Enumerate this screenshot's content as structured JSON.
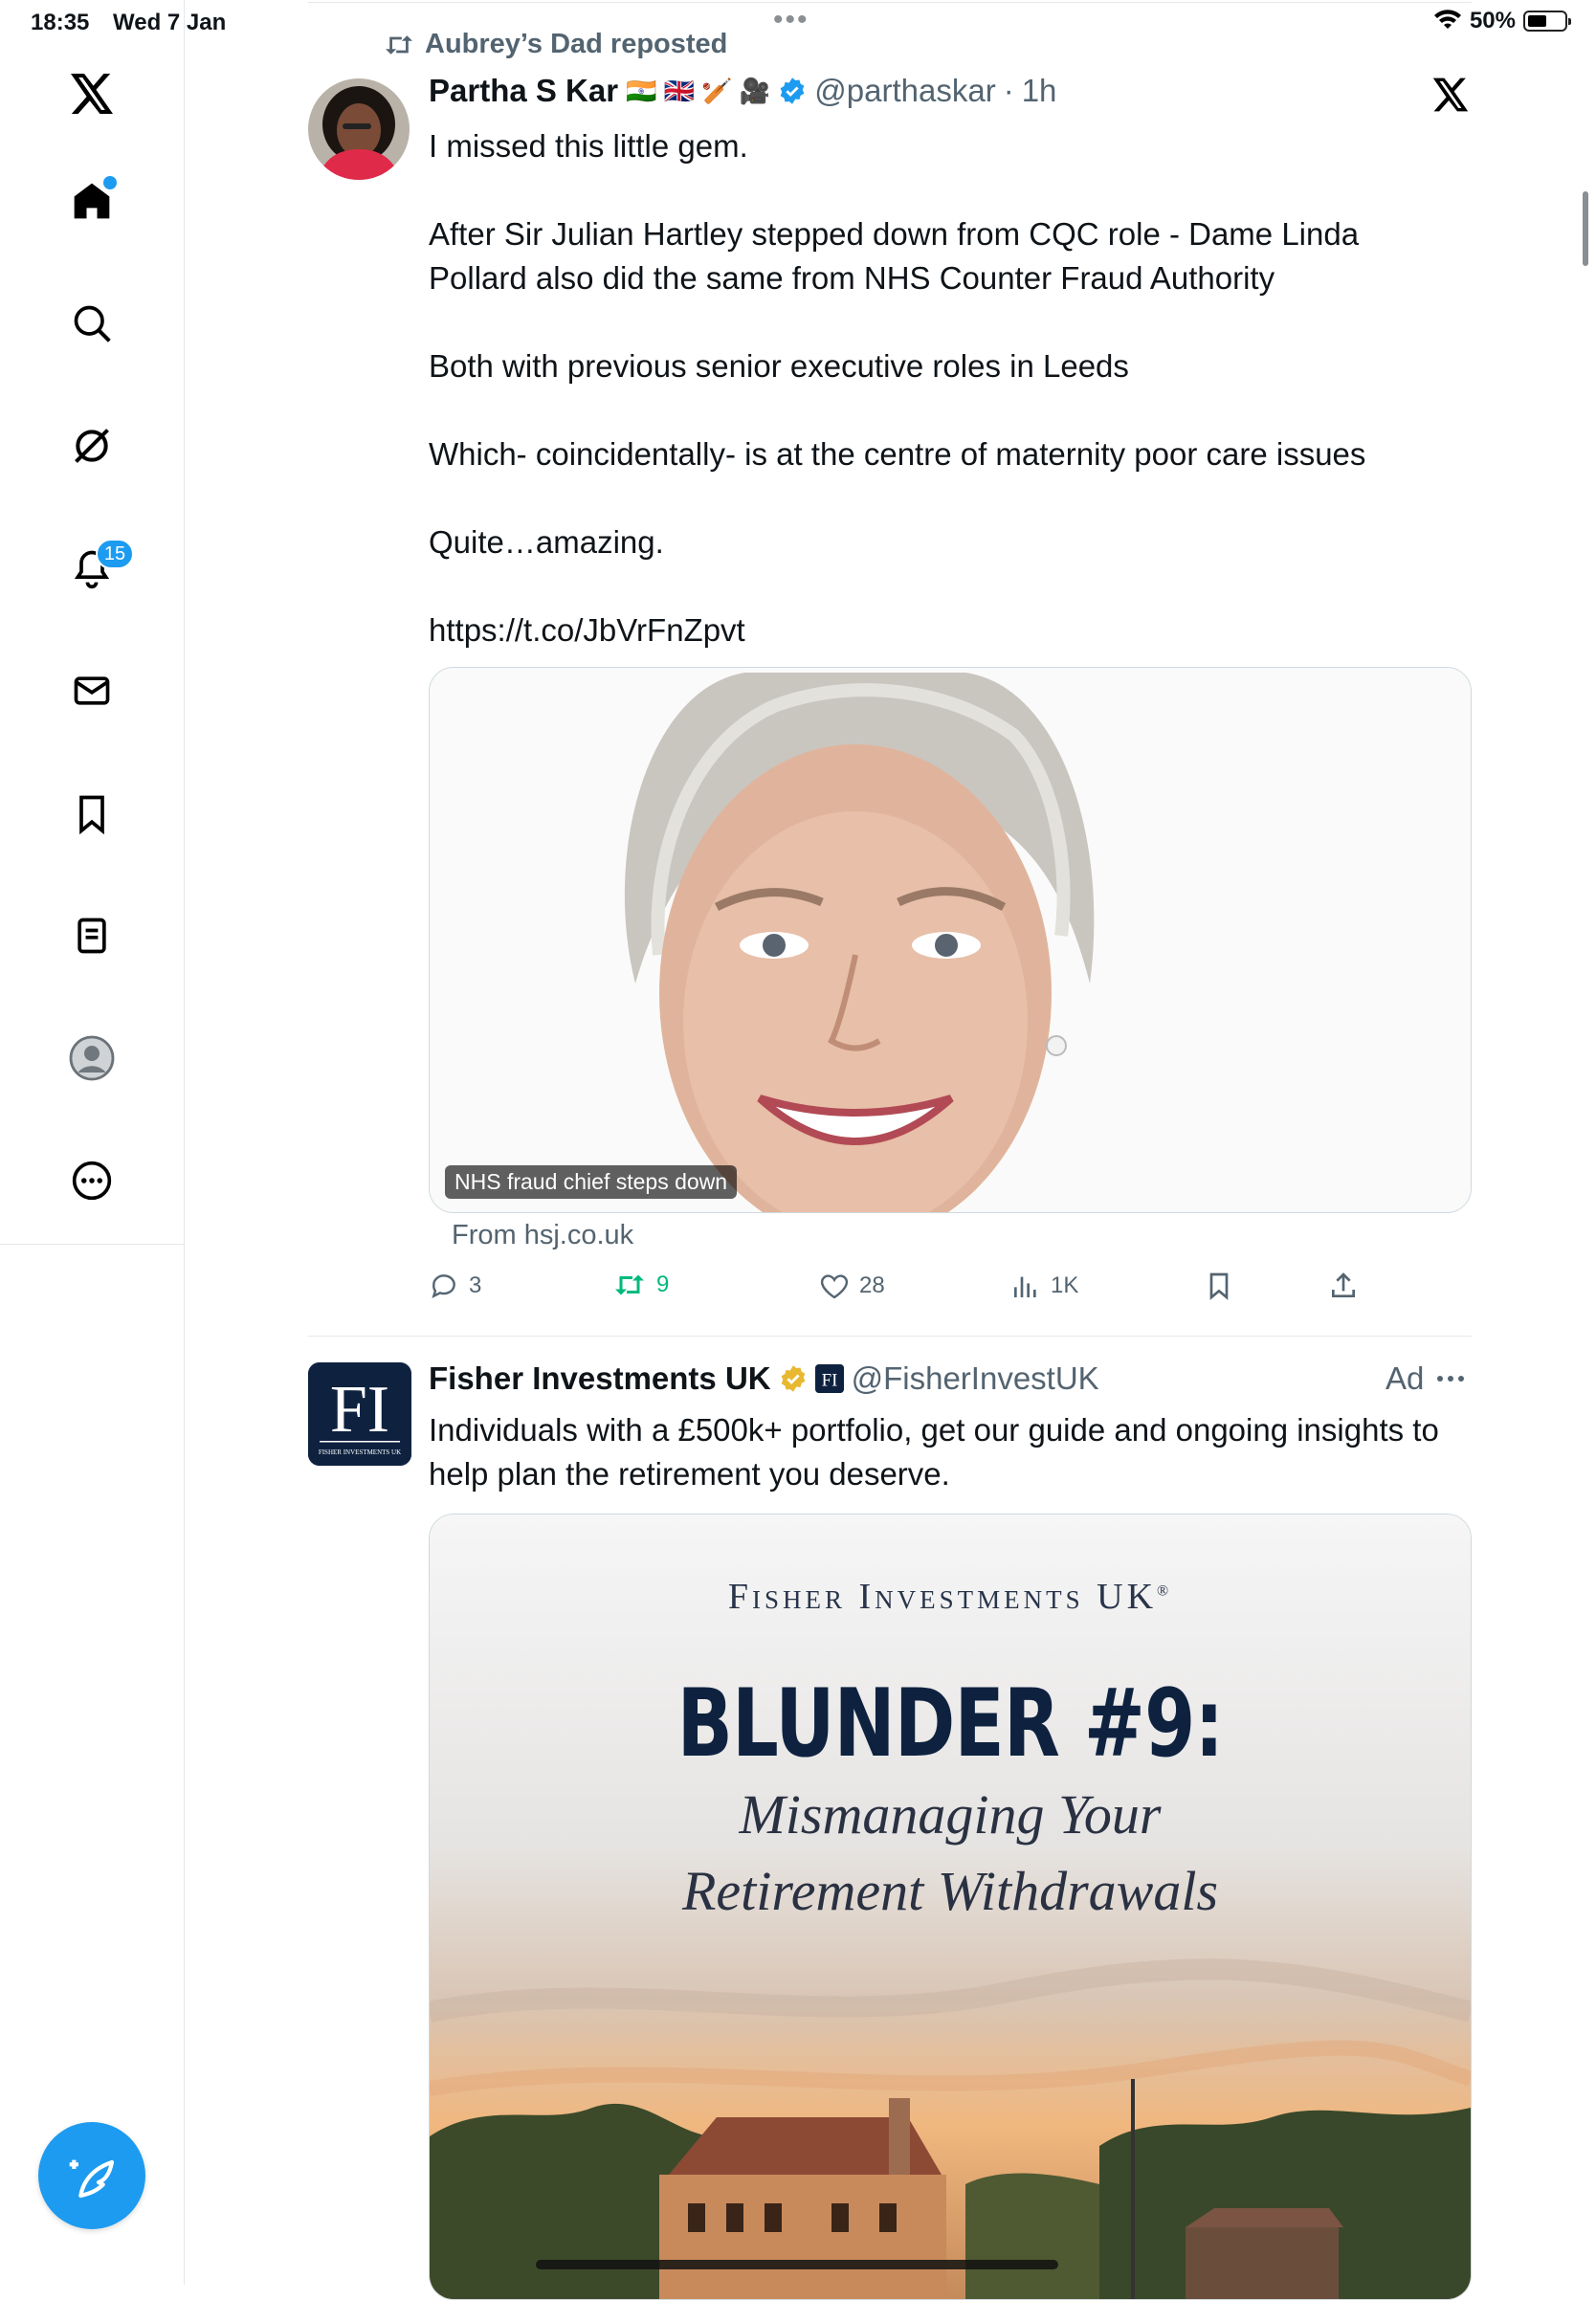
{
  "status": {
    "time": "18:35",
    "date": "Wed 7 Jan",
    "battery": "50%",
    "battery_level": 0.5
  },
  "rail": {
    "notifications_count": "15"
  },
  "tweet": {
    "repost_by": "Aubrey’s Dad reposted",
    "author_name": "Partha S Kar",
    "author_flags": "🇮🇳 🇬🇧 🏏 🎥",
    "handle": "@parthaskar",
    "separator": "·",
    "time_ago": "1h",
    "text": "I missed this little gem.\n\nAfter Sir Julian Hartley stepped down from CQC role - Dame Linda Pollard also did the same from NHS Counter Fraud Authority\n\nBoth with previous senior executive roles in Leeds\n\nWhich- coincidentally- is at the centre of maternity poor care issues\n\nQuite…amazing.\n\nhttps://t.co/JbVrFnZpvt",
    "card_title": "NHS fraud chief steps down",
    "card_source": "From hsj.co.uk",
    "replies": "3",
    "reposts": "9",
    "likes": "28",
    "views": "1K"
  },
  "ad": {
    "name": "Fisher Investments UK",
    "handle": "@FisherInvestUK",
    "ad_label": "Ad",
    "logo_text": "FI",
    "logo_sub": "FISHER INVESTMENTS UK",
    "text": "Individuals with a £500k+ portfolio, get our guide and ongoing insights to help plan the retirement you deserve.",
    "image_brand": "Fisher Investments UK",
    "image_brand_mark": "®",
    "image_headline": "BLUNDER #9:",
    "image_sub1": "Mismanaging Your",
    "image_sub2": "Retirement Withdrawals"
  },
  "colors": {
    "accent": "#1d9bf0",
    "repost_green": "#00ba7c",
    "muted": "#536471",
    "gold": "#e8b830"
  }
}
